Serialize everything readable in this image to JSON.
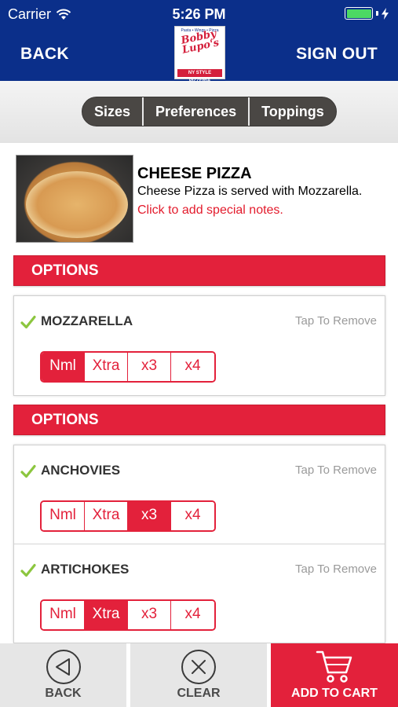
{
  "status_bar": {
    "carrier": "Carrier",
    "time": "5:26 PM"
  },
  "header": {
    "back_label": "BACK",
    "signout_label": "SIGN OUT",
    "logo_text": "Bobby Lupo's"
  },
  "segments": [
    "Sizes",
    "Preferences",
    "Toppings"
  ],
  "item": {
    "title": "CHEESE PIZZA",
    "description": "Cheese Pizza is served with Mozzarella.",
    "notes_link": "Click to add special notes."
  },
  "option_groups": [
    {
      "header": "OPTIONS",
      "items": [
        {
          "name": "MOZZARELLA",
          "remove_label": "Tap To Remove",
          "quantities": [
            "Nml",
            "Xtra",
            "x3",
            "x4"
          ],
          "selected": "Nml"
        }
      ]
    },
    {
      "header": "OPTIONS",
      "items": [
        {
          "name": "ANCHOVIES",
          "remove_label": "Tap To Remove",
          "quantities": [
            "Nml",
            "Xtra",
            "x3",
            "x4"
          ],
          "selected": "x3"
        },
        {
          "name": "ARTICHOKES",
          "remove_label": "Tap To Remove",
          "quantities": [
            "Nml",
            "Xtra",
            "x3",
            "x4"
          ],
          "selected": "Xtra"
        }
      ]
    }
  ],
  "bottom_bar": {
    "back_label": "BACK",
    "clear_label": "CLEAR",
    "cart_label": "ADD TO CART"
  },
  "colors": {
    "header_blue": "#0b2f8a",
    "accent_red": "#e3213b",
    "check_green": "#8cc63f"
  }
}
